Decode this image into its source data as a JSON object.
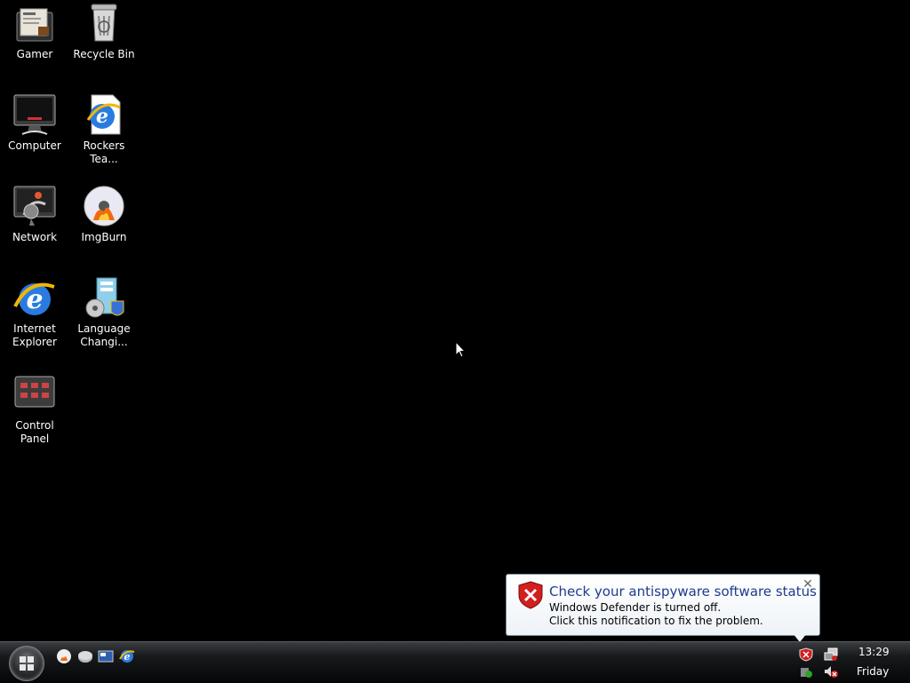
{
  "desktop": {
    "icons": [
      {
        "label": "Gamer",
        "icon": "folder-icon"
      },
      {
        "label": "Recycle Bin",
        "icon": "recycle-bin-icon"
      },
      {
        "label": "Computer",
        "icon": "computer-icon"
      },
      {
        "label": "Rockers Tea...",
        "icon": "ie-shortcut-icon"
      },
      {
        "label": "Network",
        "icon": "network-icon"
      },
      {
        "label": "ImgBurn",
        "icon": "imgburn-icon"
      },
      {
        "label": "Internet Explorer",
        "icon": "internet-explorer-icon"
      },
      {
        "label": "Language Changi...",
        "icon": "language-changer-icon"
      },
      {
        "label": "Control Panel",
        "icon": "control-panel-icon"
      }
    ]
  },
  "notification": {
    "title": "Check your antispyware software status",
    "line1": "Windows Defender is turned off.",
    "line2": "Click this notification to fix the problem.",
    "close_glyph": "✕",
    "icon": "security-shield-error-icon"
  },
  "taskbar": {
    "clock_time": "13:29",
    "clock_day": "Friday",
    "quick_launch": [
      "imgburn-icon",
      "disc-icon",
      "show-desktop-icon",
      "internet-explorer-icon"
    ],
    "tray": [
      "security-alert-icon",
      "network-status-icon",
      "safely-remove-icon",
      "volume-muted-icon"
    ]
  },
  "colors": {
    "desktop_bg": "#000000",
    "balloon_title": "#1f3b8c"
  }
}
